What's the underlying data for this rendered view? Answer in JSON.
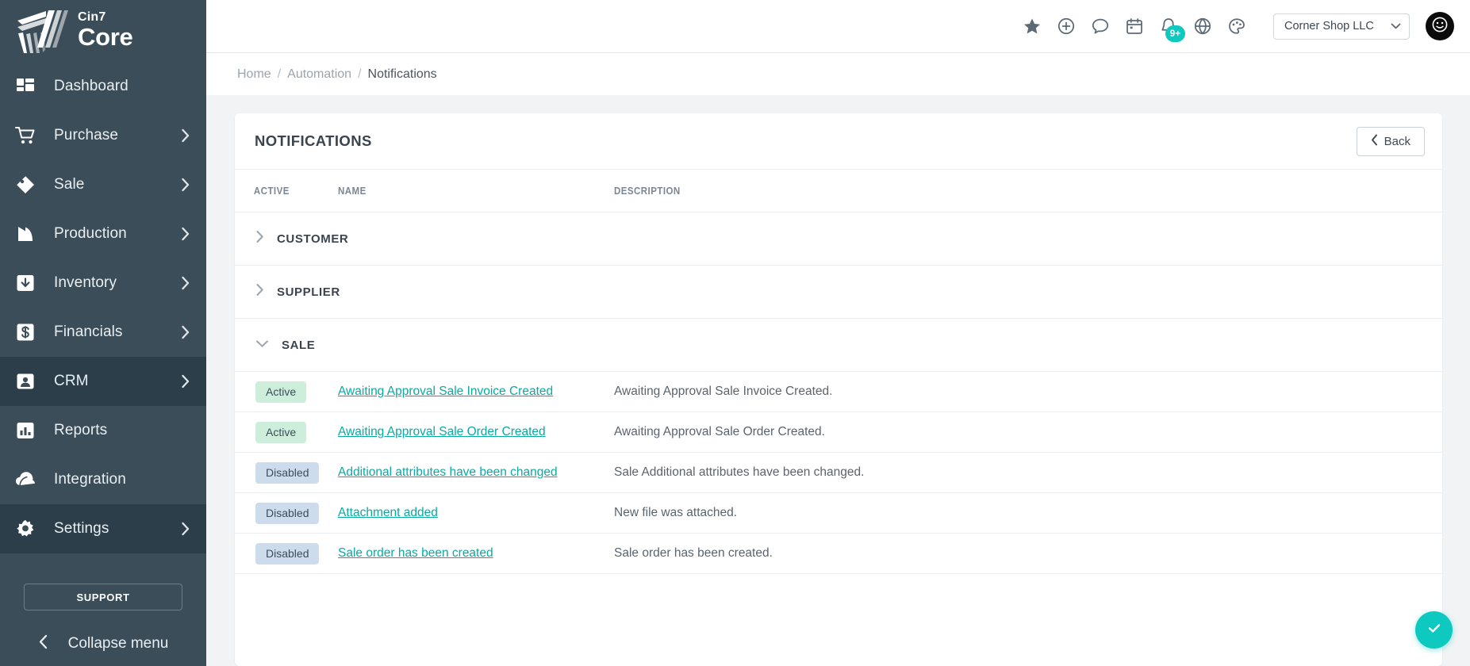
{
  "brand": {
    "name_top": "Cin7",
    "name_bottom": "Core"
  },
  "sidebar": {
    "items": [
      {
        "label": "Dashboard",
        "icon": "dashboard-icon",
        "has_chevron": false,
        "active": false
      },
      {
        "label": "Purchase",
        "icon": "cart-icon",
        "has_chevron": true,
        "active": false
      },
      {
        "label": "Sale",
        "icon": "tag-icon",
        "has_chevron": true,
        "active": false
      },
      {
        "label": "Production",
        "icon": "factory-icon",
        "has_chevron": true,
        "active": false
      },
      {
        "label": "Inventory",
        "icon": "inbox-down-icon",
        "has_chevron": true,
        "active": false
      },
      {
        "label": "Financials",
        "icon": "dollar-icon",
        "has_chevron": true,
        "active": false
      },
      {
        "label": "CRM",
        "icon": "contact-card-icon",
        "has_chevron": true,
        "active": true
      },
      {
        "label": "Reports",
        "icon": "bar-chart-icon",
        "has_chevron": false,
        "active": false
      },
      {
        "label": "Integration",
        "icon": "cloud-icon",
        "has_chevron": false,
        "active": false
      },
      {
        "label": "Settings",
        "icon": "gear-icon",
        "has_chevron": true,
        "active": true
      }
    ],
    "support_label": "SUPPORT",
    "collapse_label": "Collapse menu"
  },
  "topbar": {
    "icons": [
      {
        "name": "star-icon",
        "badge": null
      },
      {
        "name": "plus-circle-icon",
        "badge": null
      },
      {
        "name": "chat-icon",
        "badge": null
      },
      {
        "name": "calendar-icon",
        "badge": null
      },
      {
        "name": "bell-icon",
        "badge": "9+"
      },
      {
        "name": "globe-icon",
        "badge": null
      },
      {
        "name": "palette-icon",
        "badge": null
      }
    ],
    "organization": "Corner Shop LLC",
    "avatar_icon": "smiley-avatar-icon"
  },
  "breadcrumb": {
    "items": [
      "Home",
      "Automation",
      "Notifications"
    ],
    "separator": "/"
  },
  "card": {
    "title": "NOTIFICATIONS",
    "back_label": "Back",
    "columns": [
      "ACTIVE",
      "NAME",
      "DESCRIPTION"
    ],
    "groups": [
      {
        "label": "CUSTOMER",
        "expanded": false,
        "rows": []
      },
      {
        "label": "SUPPLIER",
        "expanded": false,
        "rows": []
      },
      {
        "label": "SALE",
        "expanded": true,
        "rows": [
          {
            "status": "Active",
            "name": "Awaiting Approval Sale Invoice Created",
            "description": "Awaiting Approval Sale Invoice Created."
          },
          {
            "status": "Active",
            "name": "Awaiting Approval Sale Order Created",
            "description": "Awaiting Approval Sale Order Created."
          },
          {
            "status": "Disabled",
            "name": "Additional attributes have been changed",
            "description": "Sale Additional attributes have been changed."
          },
          {
            "status": "Disabled",
            "name": "Attachment added",
            "description": "New file was attached."
          },
          {
            "status": "Disabled",
            "name": "Sale order has been created",
            "description": "Sale order has been created."
          }
        ]
      }
    ]
  },
  "fab": {
    "icon": "check-icon"
  },
  "colors": {
    "accent": "#0dc9c0",
    "sidebar": "#3b4d59",
    "sidebar_active": "#2c3e4a",
    "link": "#0aa9a3"
  }
}
